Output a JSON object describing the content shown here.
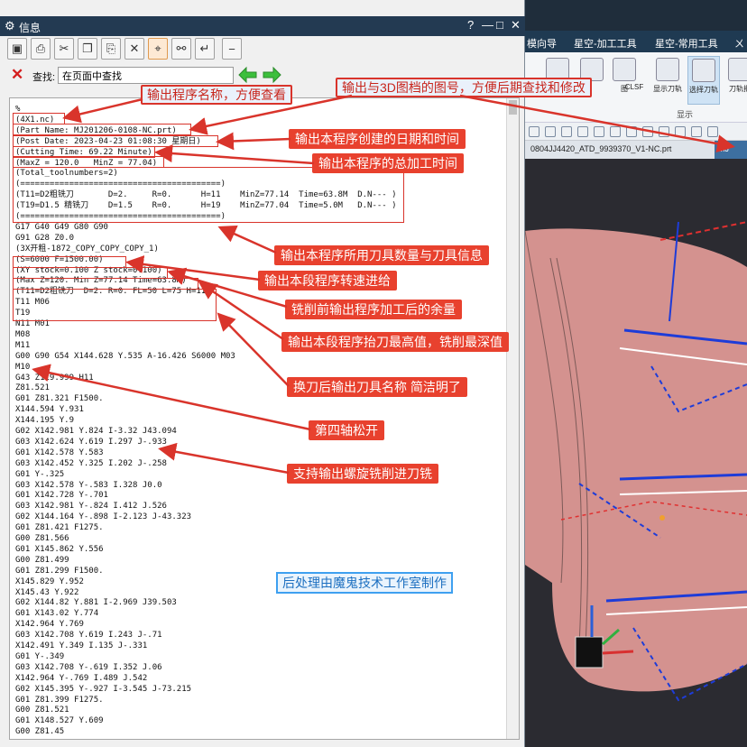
{
  "info_window": {
    "title": "信息",
    "title_controls": {
      "help": "?",
      "minimize": "—",
      "maximize": "□",
      "close": "✕"
    },
    "toolbar_icons": [
      "save-icon",
      "print-icon",
      "scissors-icon",
      "copy-icon",
      "paste-icon",
      "delete-icon",
      "crosshair-icon",
      "binoculars-icon",
      "wrap-icon",
      "minus-icon"
    ],
    "find": {
      "label": "查找:",
      "value": "在页面中查找"
    }
  },
  "code_lines": [
    "%",
    "(4X1.nc)",
    "(Part Name: MJ201206-0108-NC.prt)",
    "(Post Date: 2023-04-23 01:08:30 星期日)",
    "(Cutting Time: 69.22 Minute)",
    "(MaxZ = 120.0   MinZ = 77.04)",
    "(Total_toolnumbers=2)",
    "(=========================================)",
    "(T11=D2粗铣刀       D=2.     R=0.      H=11    MinZ=77.14  Time=63.8M  D.N--- )",
    "(T19=D1.5 精铣刀    D=1.5    R=0.      H=19    MinZ=77.04  Time=5.0M   D.N--- )",
    "(=========================================)",
    "G17 G40 G49 G80 G90",
    "G91 G28 Z0.0",
    "(3X开粗-1872_COPY_COPY_COPY_1)",
    "(S=6000 F=1500.00)",
    "(XY stock=0.100 Z stock=0.100)",
    "(Max Z=120. Min Z=77.14 Time=63.8M)",
    "(T11=D2粗铣刀  D=2. R=0. FL=50 L=75 H=11)",
    "T11 M06",
    "T19",
    "N11 M01",
    "M08",
    "M11",
    "G00 G90 G54 X144.628 Y.535 A-16.426 S6000 M03",
    "M10",
    "G43 Z119.999 H11",
    "Z81.521",
    "G01 Z81.321 F1500.",
    "X144.594 Y.931",
    "X144.195 Y.9",
    "G02 X142.981 Y.824 I-3.32 J43.094",
    "G03 X142.624 Y.619 I.297 J-.933",
    "G01 X142.578 Y.583",
    "G03 X142.452 Y.325 I.202 J-.258",
    "G01 Y-.325",
    "G03 X142.578 Y-.583 I.328 J0.0",
    "G01 X142.728 Y-.701",
    "G03 X142.981 Y-.824 I.412 J.526",
    "G02 X144.164 Y-.898 I-2.123 J-43.323",
    "G01 Z81.421 F1275.",
    "G00 Z81.566",
    "G01 X145.862 Y.556",
    "G00 Z81.499",
    "G01 Z81.299 F1500.",
    "X145.829 Y.952",
    "X145.43 Y.922",
    "G02 X144.82 Y.881 I-2.969 J39.503",
    "G01 X143.02 Y.774",
    "X142.964 Y.769",
    "G03 X142.708 Y.619 I.243 J-.71",
    "X142.491 Y.349 I.135 J-.331",
    "G01 Y-.349",
    "G03 X142.708 Y-.619 I.352 J.06",
    "X142.964 Y-.769 I.489 J.542",
    "G02 X145.395 Y-.927 I-3.545 J-73.215",
    "G01 Z81.399 F1275.",
    "G00 Z81.521",
    "G01 X148.527 Y.609",
    "G00 Z81.45"
  ],
  "annotations": {
    "program_name": "输出程序名称，方便查看",
    "drawing_number": "输出与3D图档的图号，方便后期查找和修改",
    "date_time": "输出本程序创建的日期和时间",
    "cutting_time": "输出本程序的总加工时间",
    "tool_info": "输出本程序所用刀具数量与刀具信息",
    "speed_feed": "输出本段程序转速进给",
    "stock": "铣削前输出程序加工后的余量",
    "max_min": "输出本段程序抬刀最高值，铣削最深值",
    "tool_name": "换刀后输出刀具名称  简洁明了",
    "fourth_axis": "第四轴松开",
    "helical": "支持输出螺旋铣削进刀铣",
    "credit": "后处理由魔鬼技术工作室制作"
  },
  "cad_app": {
    "tabs": [
      "模向导",
      "星空-加工工具",
      "星空-常用工具",
      "ㄨ"
    ],
    "ribbon_buttons": [
      "CLSF",
      "显示刀轨",
      "选择刀轨",
      "刀轨批"
    ],
    "ribbon_small_label": "图",
    "ribbon_group": "显示",
    "document_tab": "0804JJ4420_ATD_9939370_V1-NC.prt",
    "document_tab_active": "MJ"
  },
  "colors": {
    "annotation_red": "#d9342b",
    "title_bar": "#233a52",
    "credit_blue": "#3ea0f0",
    "part_pink": "#d4928f",
    "toolpath_blue": "#1e3cd8"
  }
}
